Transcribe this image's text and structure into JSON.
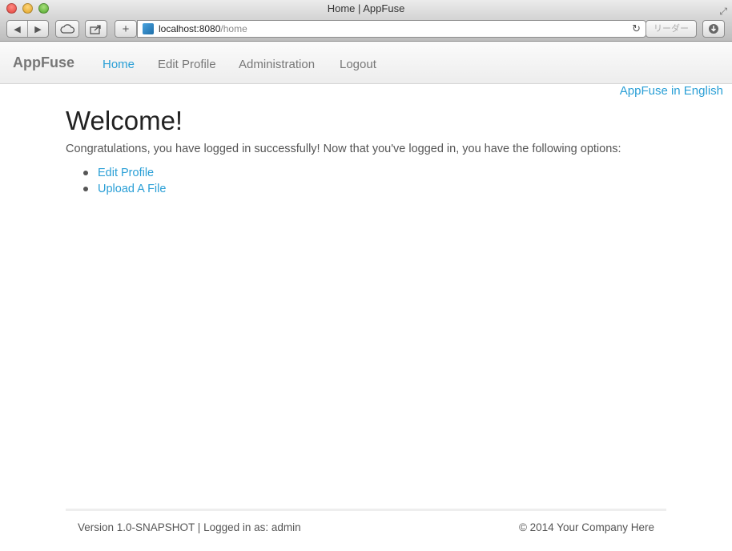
{
  "window": {
    "title": "Home | AppFuse",
    "url_host": "localhost:8080",
    "url_path": "/home",
    "reader_label": "リーダー"
  },
  "icons": {
    "back": "back-arrow-icon",
    "forward": "forward-arrow-icon",
    "cloud": "icloud-icon",
    "share": "share-icon",
    "add": "plus-icon",
    "reload": "reload-icon",
    "download": "download-icon",
    "fullscreen": "fullscreen-icon"
  },
  "navbar": {
    "brand": "AppFuse",
    "items": [
      {
        "label": "Home",
        "active": true
      },
      {
        "label": "Edit Profile",
        "active": false
      },
      {
        "label": "Administration",
        "active": false
      },
      {
        "label": "Logout",
        "active": false
      }
    ]
  },
  "language_link": "AppFuse in English",
  "main": {
    "heading": "Welcome!",
    "intro": "Congratulations, you have logged in successfully! Now that you've logged in, you have the following options:",
    "options": [
      "Edit Profile",
      "Upload A File"
    ]
  },
  "footer": {
    "left": "Version 1.0-SNAPSHOT | Logged in as: admin",
    "right": "© 2014  Your Company Here"
  },
  "colors": {
    "link": "#2a9fd6",
    "text": "#555555",
    "heading": "#222222"
  }
}
